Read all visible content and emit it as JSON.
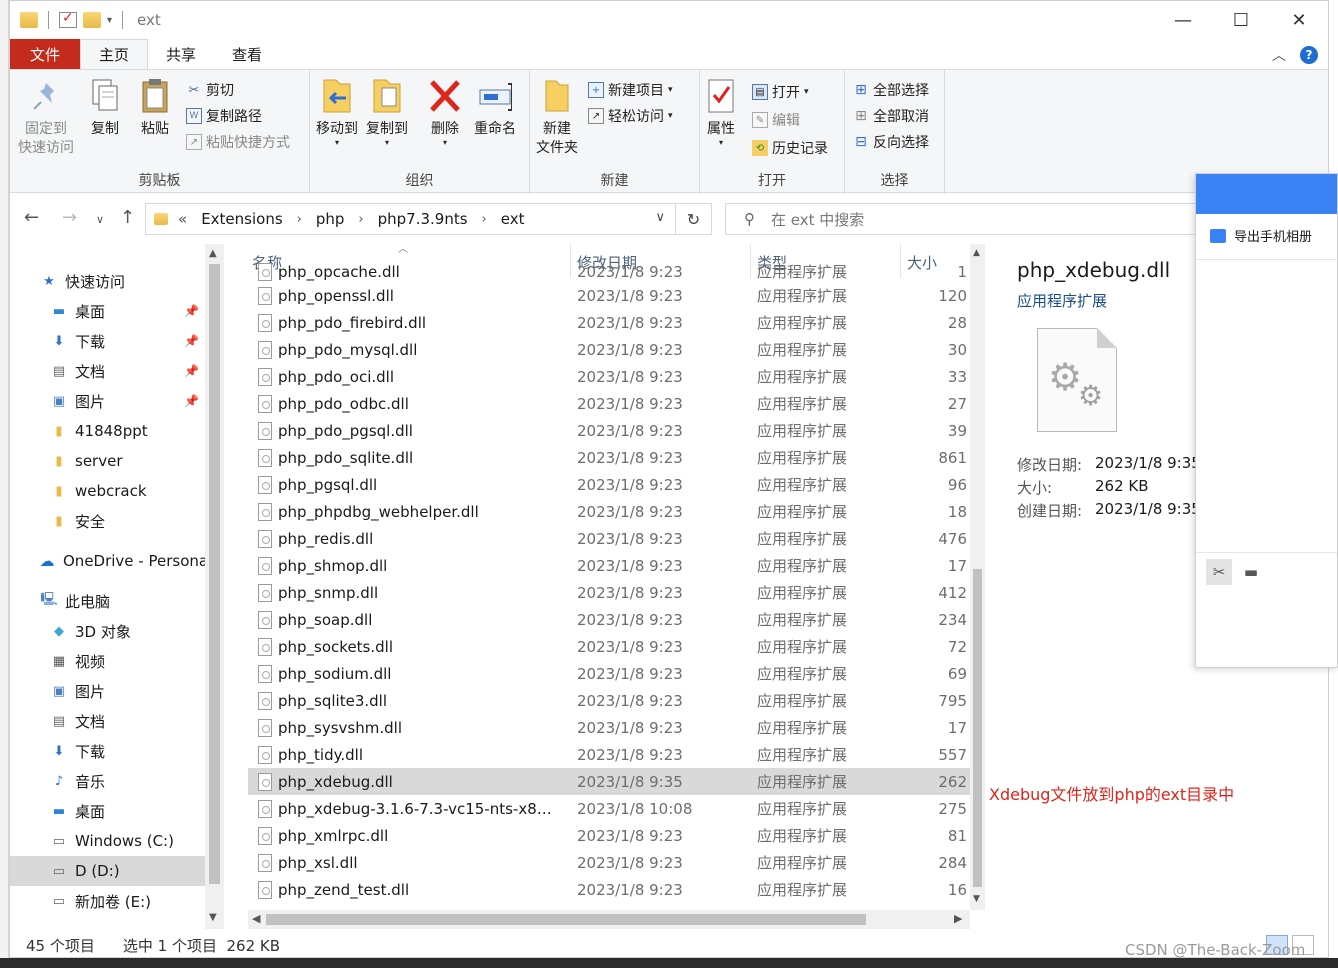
{
  "window": {
    "title": "ext"
  },
  "ribbon_tabs": [
    "文件",
    "主页",
    "共享",
    "查看"
  ],
  "ribbon": {
    "clipboard": {
      "label": "剪贴板",
      "pin": "固定到\n快速访问",
      "copy": "复制",
      "paste": "粘贴",
      "cut": "剪切",
      "copy_path": "复制路径",
      "paste_shortcut": "粘贴快捷方式"
    },
    "organize": {
      "label": "组织",
      "move_to": "移动到",
      "copy_to": "复制到",
      "delete": "删除",
      "rename": "重命名"
    },
    "new": {
      "label": "新建",
      "new_folder": "新建\n文件夹",
      "new_item": "新建项目",
      "easy_access": "轻松访问"
    },
    "open": {
      "label": "打开",
      "properties": "属性",
      "open": "打开",
      "edit": "编辑",
      "history": "历史记录"
    },
    "select": {
      "label": "选择",
      "select_all": "全部选择",
      "select_none": "全部取消",
      "invert": "反向选择"
    }
  },
  "address": {
    "overflow": "«",
    "crumbs": [
      "Extensions",
      "php",
      "php7.3.9nts",
      "ext"
    ]
  },
  "search": {
    "placeholder": "在 ext 中搜索"
  },
  "nav": {
    "quick_access": "快速访问",
    "items": [
      {
        "label": "桌面",
        "icon": "desktop-icon",
        "pinned": true
      },
      {
        "label": "下载",
        "icon": "download-icon",
        "pinned": true
      },
      {
        "label": "文档",
        "icon": "document-icon",
        "pinned": true
      },
      {
        "label": "图片",
        "icon": "picture-icon",
        "pinned": true
      },
      {
        "label": "41848ppt",
        "icon": "folder-icon",
        "pinned": false
      },
      {
        "label": "server",
        "icon": "folder-icon",
        "pinned": false
      },
      {
        "label": "webcrack",
        "icon": "folder-icon",
        "pinned": false
      },
      {
        "label": "安全",
        "icon": "folder-icon",
        "pinned": false
      }
    ],
    "onedrive": "OneDrive - Persona",
    "this_pc": "此电脑",
    "pc_items": [
      {
        "label": "3D 对象",
        "icon": "3d-objects-icon"
      },
      {
        "label": "视频",
        "icon": "video-icon"
      },
      {
        "label": "图片",
        "icon": "picture-icon"
      },
      {
        "label": "文档",
        "icon": "document-icon"
      },
      {
        "label": "下载",
        "icon": "download-icon"
      },
      {
        "label": "音乐",
        "icon": "music-icon"
      },
      {
        "label": "桌面",
        "icon": "desktop-icon"
      },
      {
        "label": "Windows (C:)",
        "icon": "drive-icon"
      },
      {
        "label": "D (D:)",
        "icon": "drive-icon"
      },
      {
        "label": "新加卷 (E:)",
        "icon": "drive-icon"
      }
    ]
  },
  "columns": {
    "name": "名称",
    "date": "修改日期",
    "type": "类型",
    "size": "大小"
  },
  "files": [
    {
      "name": "php_opcache.dll",
      "date": "2023/1/8 9:23",
      "type": "应用程序扩展",
      "size": "1"
    },
    {
      "name": "php_openssl.dll",
      "date": "2023/1/8 9:23",
      "type": "应用程序扩展",
      "size": "120"
    },
    {
      "name": "php_pdo_firebird.dll",
      "date": "2023/1/8 9:23",
      "type": "应用程序扩展",
      "size": "28"
    },
    {
      "name": "php_pdo_mysql.dll",
      "date": "2023/1/8 9:23",
      "type": "应用程序扩展",
      "size": "30"
    },
    {
      "name": "php_pdo_oci.dll",
      "date": "2023/1/8 9:23",
      "type": "应用程序扩展",
      "size": "33"
    },
    {
      "name": "php_pdo_odbc.dll",
      "date": "2023/1/8 9:23",
      "type": "应用程序扩展",
      "size": "27"
    },
    {
      "name": "php_pdo_pgsql.dll",
      "date": "2023/1/8 9:23",
      "type": "应用程序扩展",
      "size": "39"
    },
    {
      "name": "php_pdo_sqlite.dll",
      "date": "2023/1/8 9:23",
      "type": "应用程序扩展",
      "size": "861"
    },
    {
      "name": "php_pgsql.dll",
      "date": "2023/1/8 9:23",
      "type": "应用程序扩展",
      "size": "96"
    },
    {
      "name": "php_phpdbg_webhelper.dll",
      "date": "2023/1/8 9:23",
      "type": "应用程序扩展",
      "size": "18"
    },
    {
      "name": "php_redis.dll",
      "date": "2023/1/8 9:23",
      "type": "应用程序扩展",
      "size": "476"
    },
    {
      "name": "php_shmop.dll",
      "date": "2023/1/8 9:23",
      "type": "应用程序扩展",
      "size": "17"
    },
    {
      "name": "php_snmp.dll",
      "date": "2023/1/8 9:23",
      "type": "应用程序扩展",
      "size": "412"
    },
    {
      "name": "php_soap.dll",
      "date": "2023/1/8 9:23",
      "type": "应用程序扩展",
      "size": "234"
    },
    {
      "name": "php_sockets.dll",
      "date": "2023/1/8 9:23",
      "type": "应用程序扩展",
      "size": "72"
    },
    {
      "name": "php_sodium.dll",
      "date": "2023/1/8 9:23",
      "type": "应用程序扩展",
      "size": "69"
    },
    {
      "name": "php_sqlite3.dll",
      "date": "2023/1/8 9:23",
      "type": "应用程序扩展",
      "size": "795"
    },
    {
      "name": "php_sysvshm.dll",
      "date": "2023/1/8 9:23",
      "type": "应用程序扩展",
      "size": "17"
    },
    {
      "name": "php_tidy.dll",
      "date": "2023/1/8 9:23",
      "type": "应用程序扩展",
      "size": "557"
    },
    {
      "name": "php_xdebug.dll",
      "date": "2023/1/8 9:35",
      "type": "应用程序扩展",
      "size": "262",
      "selected": true
    },
    {
      "name": "php_xdebug-3.1.6-7.3-vc15-nts-x86_...",
      "date": "2023/1/8 10:08",
      "type": "应用程序扩展",
      "size": "275"
    },
    {
      "name": "php_xmlrpc.dll",
      "date": "2023/1/8 9:23",
      "type": "应用程序扩展",
      "size": "81"
    },
    {
      "name": "php_xsl.dll",
      "date": "2023/1/8 9:23",
      "type": "应用程序扩展",
      "size": "284"
    },
    {
      "name": "php_zend_test.dll",
      "date": "2023/1/8 9:23",
      "type": "应用程序扩展",
      "size": "16"
    }
  ],
  "preview": {
    "name": "php_xdebug.dll",
    "type": "应用程序扩展",
    "modified_label": "修改日期:",
    "modified": "2023/1/8 9:35",
    "size_label": "大小:",
    "size": "262 KB",
    "created_label": "创建日期:",
    "created": "2023/1/8 9:35"
  },
  "annotation": "Xdebug文件放到php的ext目录中",
  "status": {
    "count": "45 个项目",
    "selection": "选中 1 个项目  262 KB"
  },
  "overlay": {
    "export_label": "导出手机相册"
  },
  "watermark": "CSDN @The-Back-Zoom",
  "colors": {
    "file_tab": "#c42b1c",
    "selection": "#d9d9d9",
    "annotation": "#e0231b",
    "link_blue": "#1a4f8a"
  }
}
